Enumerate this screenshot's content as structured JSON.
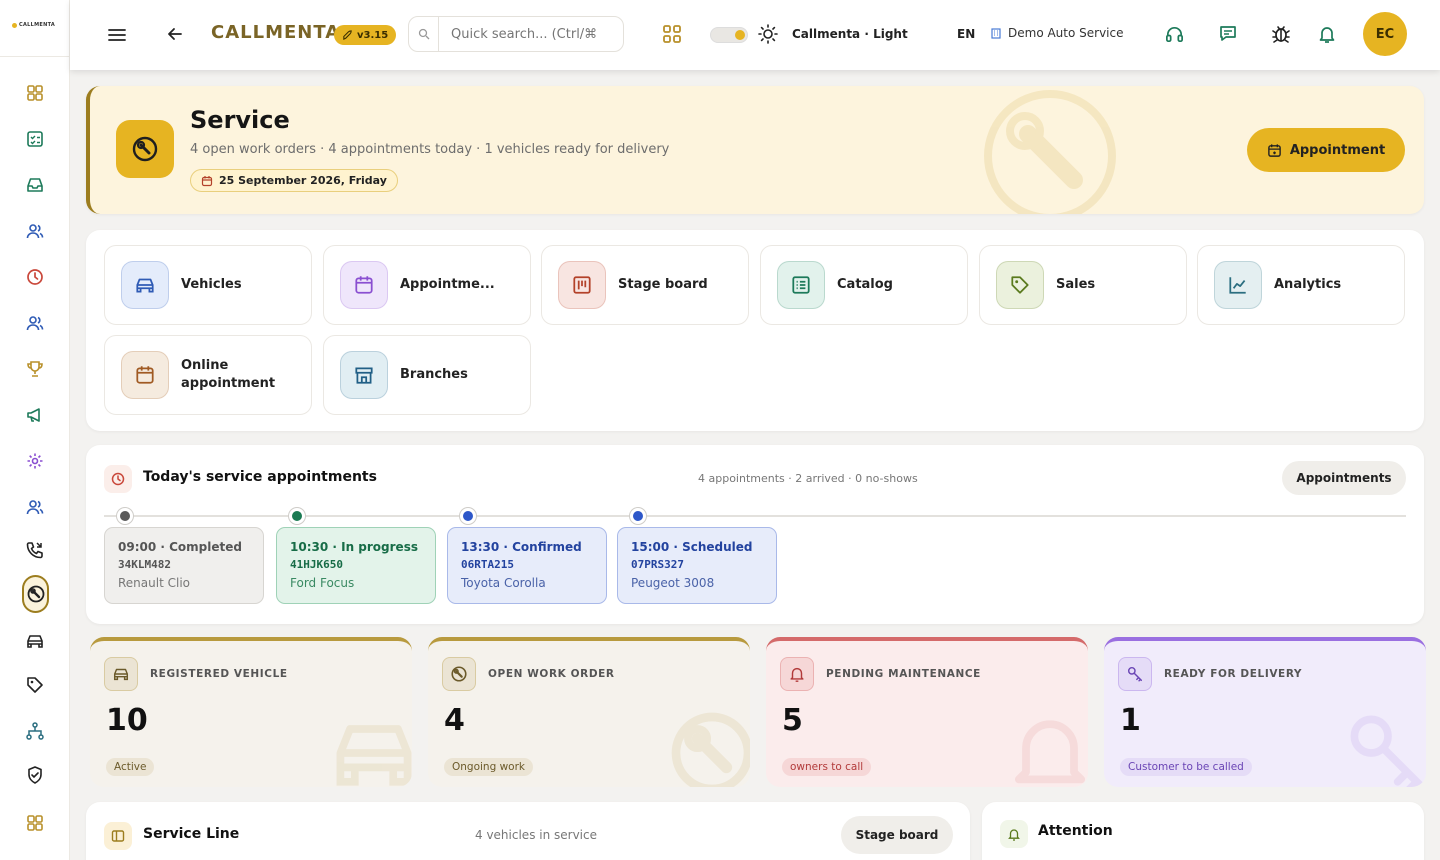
{
  "app": {
    "logo_text": "CALLMENTA",
    "brand": "CALLMENTA",
    "version": "v3.15"
  },
  "topbar": {
    "search_placeholder": "Quick search... (Ctrl/⌘",
    "theme_label": "Callmenta · Light",
    "language": "EN",
    "branch_name": "Demo Auto Service",
    "avatar_initials": "EC"
  },
  "sidebar": {
    "icons": [
      "grid-icon",
      "checklist-icon",
      "inbox-icon",
      "users-icon",
      "clock-icon",
      "users-icon",
      "trophy-icon",
      "megaphone-icon",
      "gear-icon",
      "users-icon",
      "phone-calls-icon",
      "wrench-icon",
      "car-icon",
      "tag-icon",
      "org-chart-icon",
      "shield-check-icon",
      "grid-icon"
    ],
    "active_index": 11
  },
  "hero": {
    "title": "Service",
    "subtitle": "4 open work orders · 4 appointments today · 1 vehicles ready for delivery",
    "date": "25 September 2026, Friday",
    "button_label": "Appointment"
  },
  "quick_links": [
    {
      "label": "Vehicles",
      "icon": "car-icon",
      "color": "#e4ecfb",
      "stroke": "#2f5bb5"
    },
    {
      "label": "Appointme...",
      "icon": "calendar-icon",
      "color": "#efe6fb",
      "stroke": "#8a4fd1"
    },
    {
      "label": "Stage board",
      "icon": "kanban-icon",
      "color": "#f8e5e1",
      "stroke": "#b3422a"
    },
    {
      "label": "Catalog",
      "icon": "list-icon",
      "color": "#e2f2ec",
      "stroke": "#1d7a5a"
    },
    {
      "label": "Sales",
      "icon": "tag-icon",
      "color": "#ebf1dd",
      "stroke": "#5a7a1d"
    },
    {
      "label": "Analytics",
      "icon": "chart-line-icon",
      "color": "#e4eff1",
      "stroke": "#2b6e80"
    },
    {
      "label": "Online appointment",
      "icon": "calendar-icon",
      "color": "#f5ebdf",
      "stroke": "#a05a23"
    },
    {
      "label": "Branches",
      "icon": "store-icon",
      "color": "#e1eef3",
      "stroke": "#215f86"
    }
  ],
  "appointments": {
    "title": "Today's service appointments",
    "meta": "4 appointments · 2 arrived · 0 no-shows",
    "button_label": "Appointments",
    "items": [
      {
        "time_status": "09:00 · Completed",
        "plate": "34KLM482",
        "car": "Renault Clio",
        "dot": "#5b5b5b",
        "bg": "#f0efed",
        "border": "#d7d5d1",
        "fg": "#555",
        "sub": "#777"
      },
      {
        "time_status": "10:30 · In progress",
        "plate": "41HJK650",
        "car": "Ford Focus",
        "dot": "#1a7a52",
        "bg": "#e3f3ea",
        "border": "#9fd2b7",
        "fg": "#176c47",
        "sub": "#3a8a63"
      },
      {
        "time_status": "13:30 · Confirmed",
        "plate": "06RTA215",
        "car": "Toyota Corolla",
        "dot": "#2d57c9",
        "bg": "#e7ecfa",
        "border": "#a9b9e9",
        "fg": "#23439f",
        "sub": "#4a62a8"
      },
      {
        "time_status": "15:00 · Scheduled",
        "plate": "07PRS327",
        "car": "Peugeot 3008",
        "dot": "#2d57c9",
        "bg": "#e7ecfa",
        "border": "#a9b9e9",
        "fg": "#23439f",
        "sub": "#4a62a8"
      }
    ]
  },
  "stats": [
    {
      "label": "REGISTERED VEHICLE",
      "value": "10",
      "badge": "Active",
      "icon": "car-icon",
      "top": "#b89a3e",
      "bg": "#f5f2ec",
      "icbg": "#ebe4d4",
      "badgebg": "#ebe4d4",
      "badgefg": "#6b5a2a"
    },
    {
      "label": "OPEN WORK ORDER",
      "value": "4",
      "badge": "Ongoing work",
      "icon": "wrench-icon",
      "top": "#b89a3e",
      "bg": "#f5f2ec",
      "icbg": "#ebe4d4",
      "badgebg": "#ebe4d4",
      "badgefg": "#6b5a2a"
    },
    {
      "label": "PENDING MAINTENANCE",
      "value": "5",
      "badge": "owners to call",
      "icon": "bell-icon",
      "top": "#d46a6a",
      "bg": "#fbecec",
      "icbg": "#f6d7d7",
      "badgebg": "#f6d7d7",
      "badgefg": "#b23a3a"
    },
    {
      "label": "READY FOR DELIVERY",
      "value": "1",
      "badge": "Customer to be called",
      "icon": "key-icon",
      "top": "#9a6fe0",
      "bg": "#f1ecfb",
      "icbg": "#e5dcf7",
      "badgebg": "#e5dcf7",
      "badgefg": "#6a45b5"
    }
  ],
  "service_line": {
    "title": "Service Line",
    "meta": "4 vehicles in service",
    "button_label": "Stage board"
  },
  "attention": {
    "title": "Attention"
  }
}
